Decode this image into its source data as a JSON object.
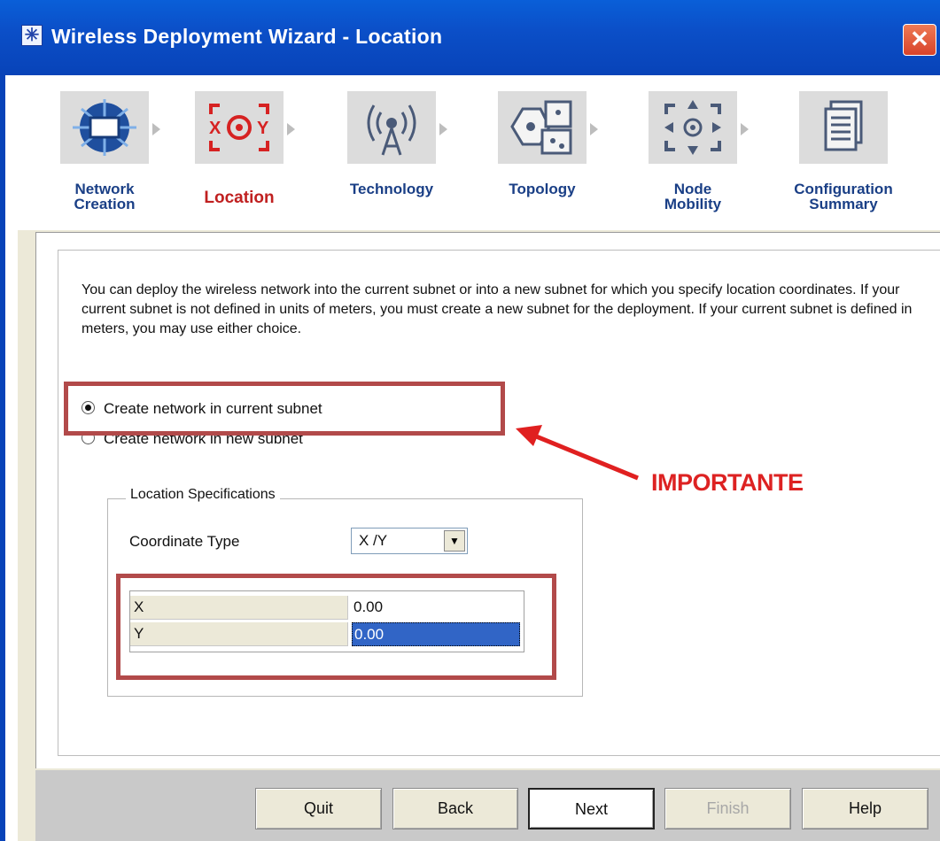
{
  "window": {
    "title": "Wireless Deployment Wizard - Location",
    "close_glyph": "✕"
  },
  "steps": [
    {
      "label": "Network\nCreation",
      "icon": "network-creation-icon",
      "active": false
    },
    {
      "label": "Location",
      "icon": "location-icon",
      "active": true
    },
    {
      "label": "Technology",
      "icon": "technology-icon",
      "active": false
    },
    {
      "label": "Topology",
      "icon": "topology-icon",
      "active": false
    },
    {
      "label": "Node\nMobility",
      "icon": "node-mobility-icon",
      "active": false
    },
    {
      "label": "Configuration\nSummary",
      "icon": "configuration-summary-icon",
      "active": false
    }
  ],
  "content": {
    "description": "You can deploy the wireless network into the current subnet or into a new subnet for which you specify location coordinates. If your current subnet is not defined in units of meters, you must create a new subnet for the deployment. If your current subnet is defined in meters, you may use either choice.",
    "radio_current": "Create network in current subnet",
    "radio_new": "Create network in new subnet",
    "annotation": "IMPORTANTE"
  },
  "location": {
    "group_title": "Location Specifications",
    "coord_type_label": "Coordinate Type",
    "coord_type_value": "X /Y",
    "rows": [
      {
        "key": "X",
        "value": "0.00"
      },
      {
        "key": "Y",
        "value": "0.00"
      }
    ]
  },
  "buttons": {
    "quit": "Quit",
    "back": "Back",
    "next": "Next",
    "finish": "Finish",
    "help": "Help"
  },
  "colors": {
    "title_bar": "#0b4fc8",
    "active_step": "#c02020",
    "step_label": "#1a3f86",
    "highlight_box": "#b24a4a",
    "annotation": "#dd2222"
  }
}
